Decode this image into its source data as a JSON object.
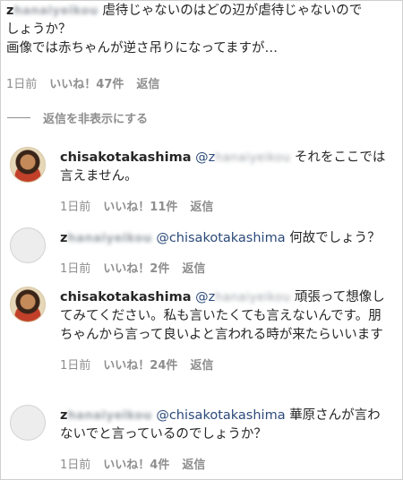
{
  "top_comment": {
    "user_initial": "z",
    "user_blurred": "hanaiyeikou",
    "text_line1": "虐待じゃないのはどの辺が虐待じゃないので",
    "text_line2": "しょうか？",
    "text_line3": "画像では赤ちゃんが逆さ吊りになってますが…",
    "time": "1日前",
    "likes": "いいね！47件",
    "reply": "返信"
  },
  "hide_replies_label": "返信を非表示にする",
  "replies": [
    {
      "user": "chisakotakashima",
      "mention_initial": "@z",
      "mention_blurred": "hanaiyeikou",
      "text": "それをここでは言えません。",
      "time": "1日前",
      "likes": "いいね！11件",
      "reply": "返信"
    },
    {
      "user_initial": "z",
      "user_blurred": "hanaiyeikou",
      "mention": "@chisakotakashima",
      "text": "何故でしょう？",
      "time": "1日前",
      "likes": "いいね！2件",
      "reply": "返信"
    },
    {
      "user": "chisakotakashima",
      "mention_initial": "@z",
      "mention_blurred": "hanaiyeikou",
      "text": "頑張って想像してみてください。私も言いたくても言えないんです。朋ちゃんから言って良いよと言われる時が来たらいいます",
      "time": "1日前",
      "likes": "いいね！24件",
      "reply": "返信"
    },
    {
      "user_initial": "z",
      "user_blurred": "hanaiyeikou",
      "mention": "@chisakotakashima",
      "text": "華原さんが言わないでと言っているのでしょうか？",
      "time": "1日前",
      "likes": "いいね！4件",
      "reply": "返信"
    }
  ]
}
